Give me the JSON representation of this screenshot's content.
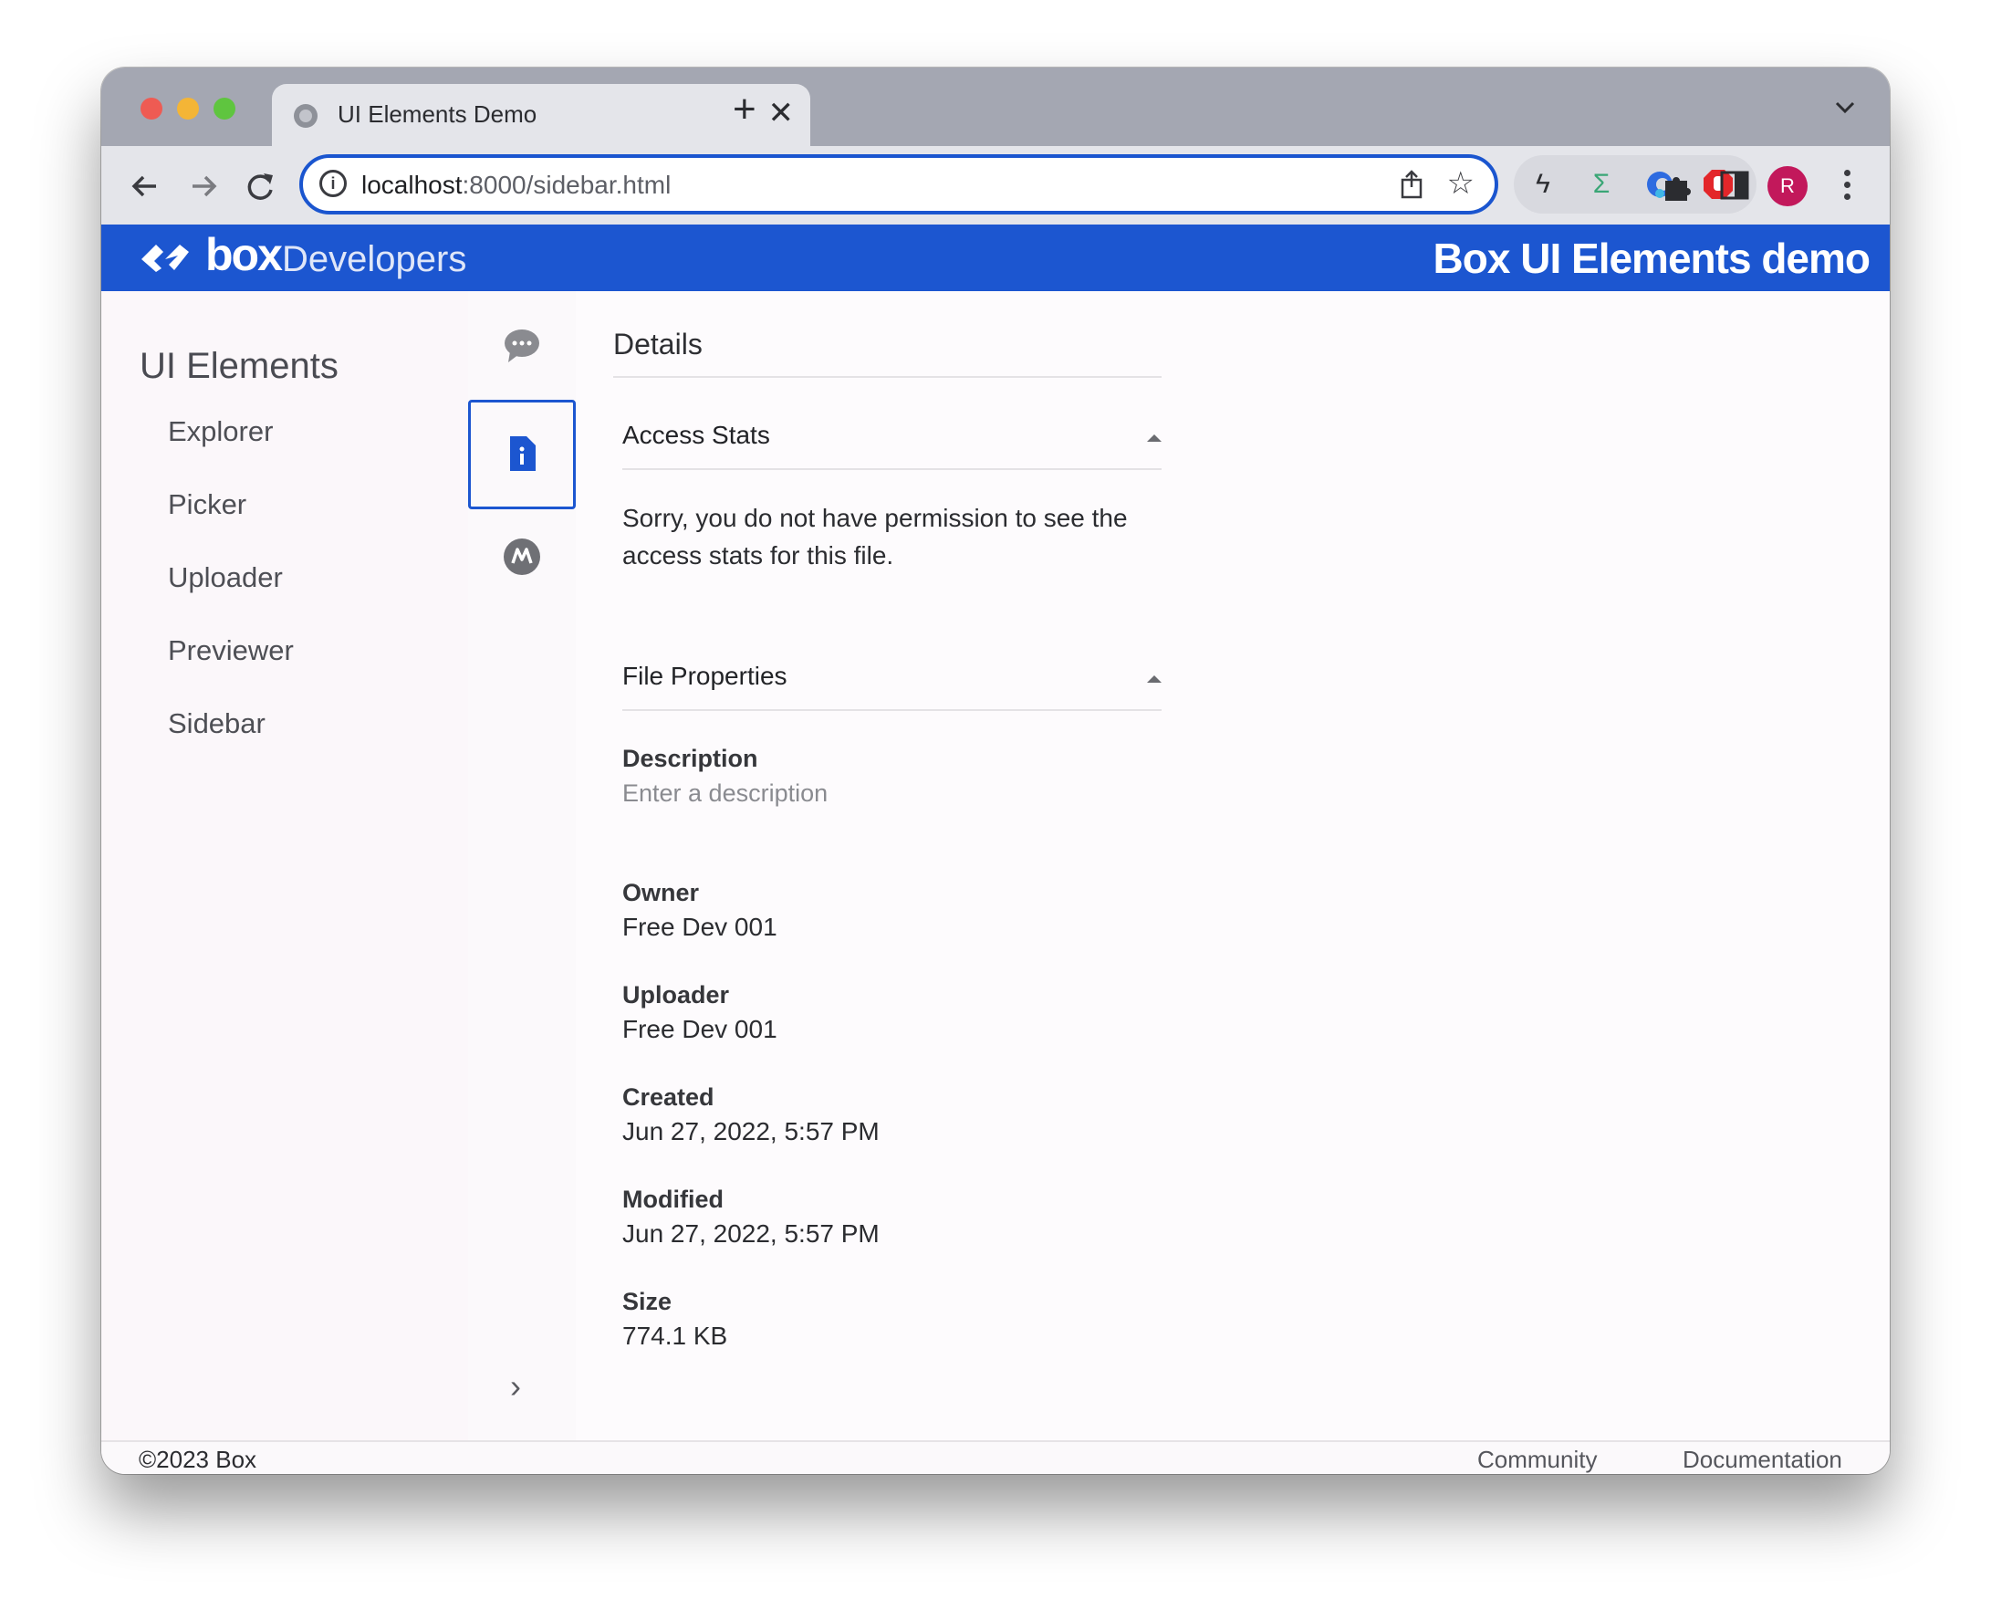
{
  "browser": {
    "tab_title": "UI Elements Demo",
    "tab_close": "✕",
    "new_tab": "+",
    "url_host": "localhost",
    "url_path": ":8000/sidebar.html",
    "profile_initial": "R",
    "icons": [
      "back-icon",
      "forward-icon",
      "reload-icon",
      "info-icon",
      "share-icon",
      "star-icon",
      "bolt-extension-icon",
      "sigma-extension-icon",
      "edge-extension-icon",
      "stop-extension-icon",
      "puzzle-extensions-icon",
      "side-panel-icon",
      "kebab-menu-icon"
    ]
  },
  "header": {
    "logo_box": "box",
    "logo_developers": "Developers",
    "title": "Box UI Elements demo",
    "brand_color": "#1c56d0"
  },
  "leftnav": {
    "heading": "UI Elements",
    "items": [
      {
        "label": "Explorer"
      },
      {
        "label": "Picker"
      },
      {
        "label": "Uploader"
      },
      {
        "label": "Previewer"
      },
      {
        "label": "Sidebar"
      }
    ]
  },
  "rail": {
    "icons": [
      "comment-icon",
      "file-info-icon",
      "metadata-icon"
    ],
    "expand": "›"
  },
  "details": {
    "title": "Details",
    "access_stats": {
      "heading": "Access Stats",
      "message": "Sorry, you do not have permission to see the access stats for this file."
    },
    "file_properties": {
      "heading": "File Properties",
      "description_label": "Description",
      "description_placeholder": "Enter a description",
      "owner_label": "Owner",
      "owner_value": "Free Dev 001",
      "uploader_label": "Uploader",
      "uploader_value": "Free Dev 001",
      "created_label": "Created",
      "created_value": "Jun 27, 2022, 5:57 PM",
      "modified_label": "Modified",
      "modified_value": "Jun 27, 2022, 5:57 PM",
      "size_label": "Size",
      "size_value": "774.1 KB"
    }
  },
  "footer": {
    "copyright": "©2023 Box",
    "community": "Community",
    "documentation": "Documentation"
  }
}
